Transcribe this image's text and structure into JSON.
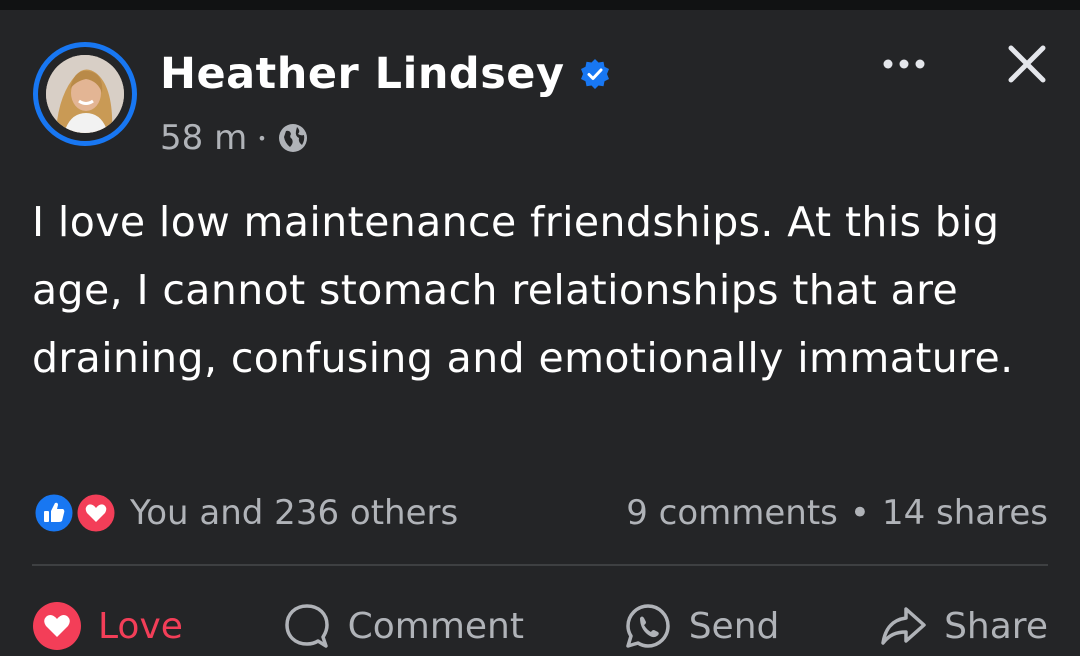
{
  "post": {
    "author_name": "Heather Lindsey",
    "verified_icon": "verified-badge-icon",
    "timestamp": "58 m",
    "separator": "•",
    "audience_icon": "globe-icon",
    "text": "I love low maintenance friendships. At this big age, I cannot stomach relationships that are draining, confusing and emotionally immature."
  },
  "engagement": {
    "reaction_icons": [
      "like-icon",
      "love-icon"
    ],
    "reactions_text": "You and 236 others",
    "comments": "9 comments",
    "separator": "•",
    "shares": "14 shares"
  },
  "actions": {
    "love_label": "Love",
    "comment_label": "Comment",
    "send_label": "Send",
    "share_label": "Share"
  },
  "colors": {
    "background": "#242527",
    "accent_blue": "#1877f2",
    "love_red": "#f33e58",
    "text_primary": "#ffffff",
    "text_secondary": "#b0b3b8"
  }
}
